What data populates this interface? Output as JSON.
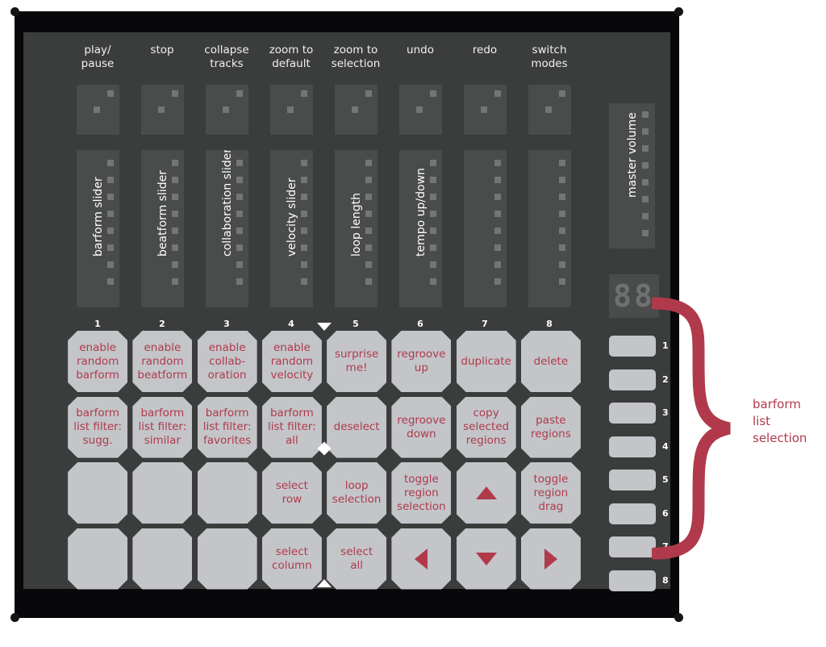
{
  "device": {
    "title": "midi-controller-panel",
    "colors": {
      "frame": "#08080a",
      "panel": "#3b3c3c",
      "pad": "#4a4b4b",
      "led": "#747575",
      "button_face": "#c3c5c9",
      "accent_red": "#b03a4b",
      "label_white": "#ffffff",
      "display_digit": "#6f7071"
    }
  },
  "top_labels": [
    "play/\npause",
    "stop",
    "collapse\ntracks",
    "zoom to\ndefault",
    "zoom to\nselection",
    "undo",
    "redo",
    "switch\nmodes"
  ],
  "sliders": {
    "labels": [
      "barform slider",
      "beatform slider",
      "collaboration slider",
      "velocity slider",
      "loop length",
      "tempo up/down",
      "",
      ""
    ],
    "led_count": 8,
    "column_numbers": [
      "1",
      "2",
      "3",
      "4",
      "5",
      "6",
      "7",
      "8"
    ]
  },
  "master": {
    "label": "master volume",
    "led_count": 8,
    "display_value": "88"
  },
  "grid": {
    "rows": [
      [
        {
          "label": "enable\nrandom\nbarform",
          "icon": ""
        },
        {
          "label": "enable\nrandom\nbeatform",
          "icon": ""
        },
        {
          "label": "enable\ncollab-\noration",
          "icon": ""
        },
        {
          "label": "enable\nrandom\nvelocity",
          "icon": ""
        },
        {
          "label": "surprise\nme!",
          "icon": ""
        },
        {
          "label": "regroove\nup",
          "icon": ""
        },
        {
          "label": "duplicate",
          "icon": ""
        },
        {
          "label": "delete",
          "icon": ""
        }
      ],
      [
        {
          "label": "barform\nlist filter:\nsugg.",
          "icon": ""
        },
        {
          "label": "barform\nlist filter:\nsimilar",
          "icon": ""
        },
        {
          "label": "barform\nlist filter:\nfavorites",
          "icon": ""
        },
        {
          "label": "barform\nlist filter:\nall",
          "icon": ""
        },
        {
          "label": "deselect",
          "icon": ""
        },
        {
          "label": "regroove\ndown",
          "icon": ""
        },
        {
          "label": "copy\nselected\nregions",
          "icon": ""
        },
        {
          "label": "paste\nregions",
          "icon": ""
        }
      ],
      [
        {
          "label": "",
          "icon": ""
        },
        {
          "label": "",
          "icon": ""
        },
        {
          "label": "",
          "icon": ""
        },
        {
          "label": "select\nrow",
          "icon": ""
        },
        {
          "label": "loop\nselection",
          "icon": ""
        },
        {
          "label": "toggle\nregion\nselection",
          "icon": ""
        },
        {
          "label": "",
          "icon": "triangle-up-icon"
        },
        {
          "label": "toggle\nregion\ndrag",
          "icon": ""
        }
      ],
      [
        {
          "label": "",
          "icon": ""
        },
        {
          "label": "",
          "icon": ""
        },
        {
          "label": "",
          "icon": ""
        },
        {
          "label": "select\ncolumn",
          "icon": ""
        },
        {
          "label": "select\nall",
          "icon": ""
        },
        {
          "label": "",
          "icon": "triangle-left-icon"
        },
        {
          "label": "",
          "icon": "triangle-down-icon"
        },
        {
          "label": "",
          "icon": "triangle-right-icon"
        }
      ]
    ]
  },
  "side_buttons": {
    "numbers": [
      "1",
      "2",
      "3",
      "4",
      "5",
      "6",
      "7",
      "8"
    ]
  },
  "annotation": {
    "caption": "barform\nlist\nselection"
  }
}
